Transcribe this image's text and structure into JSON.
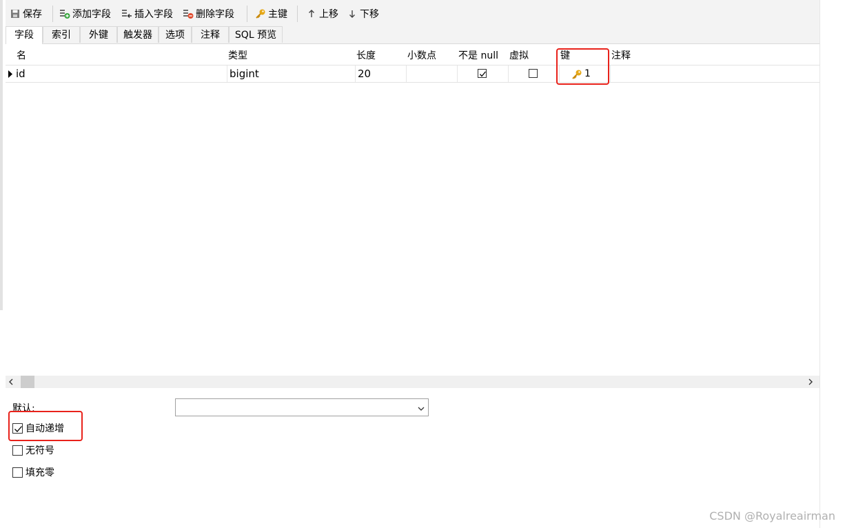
{
  "toolbar": {
    "save": "保存",
    "add_field": "添加字段",
    "insert_field": "插入字段",
    "delete_field": "删除字段",
    "primary_key": "主键",
    "move_up": "上移",
    "move_down": "下移"
  },
  "tabs": [
    "字段",
    "索引",
    "外键",
    "触发器",
    "选项",
    "注释",
    "SQL 预览"
  ],
  "columns": [
    "名",
    "类型",
    "长度",
    "小数点",
    "不是 null",
    "虚拟",
    "键",
    "注释"
  ],
  "rows": [
    {
      "name": "id",
      "type": "bigint",
      "length": "20",
      "decimals": "",
      "not_null": true,
      "virtual": false,
      "key": "1",
      "comment": ""
    }
  ],
  "options": {
    "default_label": "默认:",
    "default_value": "",
    "auto_increment": {
      "label": "自动递增",
      "checked": true
    },
    "unsigned": {
      "label": "无符号",
      "checked": false
    },
    "zerofill": {
      "label": "填充零",
      "checked": false
    }
  },
  "watermark": "CSDN @Royalreairman",
  "colors": {
    "highlight": "#e8211a",
    "key_icon": "#e6a817"
  }
}
